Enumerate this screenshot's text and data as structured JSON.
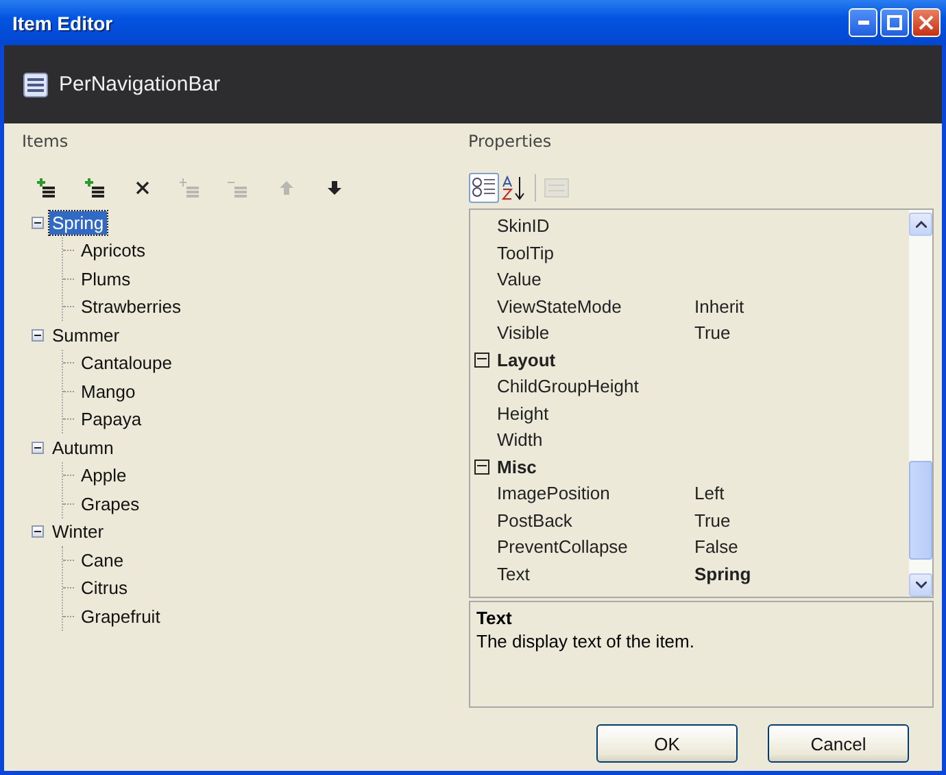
{
  "window": {
    "title": "Item Editor"
  },
  "header": {
    "title": "PerNavigationBar"
  },
  "items_panel": {
    "label": "Items",
    "toolbar": [
      {
        "kind": "add-root",
        "disabled": false
      },
      {
        "kind": "add-child",
        "disabled": false
      },
      {
        "kind": "delete",
        "disabled": false
      },
      {
        "kind": "indent",
        "disabled": true
      },
      {
        "kind": "outdent",
        "disabled": true
      },
      {
        "kind": "up",
        "disabled": true
      },
      {
        "kind": "down",
        "disabled": false
      }
    ],
    "tree": [
      {
        "label": "Spring",
        "selected": true,
        "expanded": true,
        "children": [
          {
            "label": "Apricots",
            "selected": false
          },
          {
            "label": "Plums",
            "selected": false
          },
          {
            "label": "Strawberries",
            "selected": false
          }
        ]
      },
      {
        "label": "Summer",
        "selected": false,
        "expanded": true,
        "children": [
          {
            "label": "Cantaloupe",
            "selected": false
          },
          {
            "label": "Mango",
            "selected": false
          },
          {
            "label": "Papaya",
            "selected": false
          }
        ]
      },
      {
        "label": "Autumn",
        "selected": false,
        "expanded": true,
        "children": [
          {
            "label": "Apple",
            "selected": false
          },
          {
            "label": "Grapes",
            "selected": false
          }
        ]
      },
      {
        "label": "Winter",
        "selected": false,
        "expanded": true,
        "children": [
          {
            "label": "Cane",
            "selected": false
          },
          {
            "label": "Citrus",
            "selected": false
          },
          {
            "label": "Grapefruit",
            "selected": false
          }
        ]
      }
    ]
  },
  "properties_panel": {
    "label": "Properties",
    "toolbar": [
      {
        "kind": "categorized",
        "selected": true,
        "disabled": false
      },
      {
        "kind": "alphabetical",
        "selected": false,
        "disabled": false
      },
      {
        "kind": "property-pages",
        "selected": false,
        "disabled": true
      }
    ],
    "rows": [
      {
        "kind": "property",
        "name": "SkinID"
      },
      {
        "kind": "property",
        "name": "ToolTip"
      },
      {
        "kind": "property",
        "name": "Value"
      },
      {
        "kind": "property",
        "name": "ViewStateMode",
        "value": "Inherit",
        "modified": false
      },
      {
        "kind": "property",
        "name": "Visible",
        "value": "True",
        "modified": false
      },
      {
        "kind": "category",
        "name": "Layout",
        "expanded": true
      },
      {
        "kind": "property",
        "name": "ChildGroupHeight"
      },
      {
        "kind": "property",
        "name": "Height"
      },
      {
        "kind": "property",
        "name": "Width"
      },
      {
        "kind": "category",
        "name": "Misc",
        "expanded": true
      },
      {
        "kind": "property",
        "name": "ImagePosition",
        "value": "Left",
        "modified": false
      },
      {
        "kind": "property",
        "name": "PostBack",
        "value": "True",
        "modified": false
      },
      {
        "kind": "property",
        "name": "PreventCollapse",
        "value": "False",
        "modified": false
      },
      {
        "kind": "property",
        "name": "Text",
        "value": "Spring",
        "modified": true
      }
    ],
    "description": {
      "title": "Text",
      "text": "The display text of the item."
    }
  },
  "buttons": [
    "OK",
    "Cancel"
  ]
}
